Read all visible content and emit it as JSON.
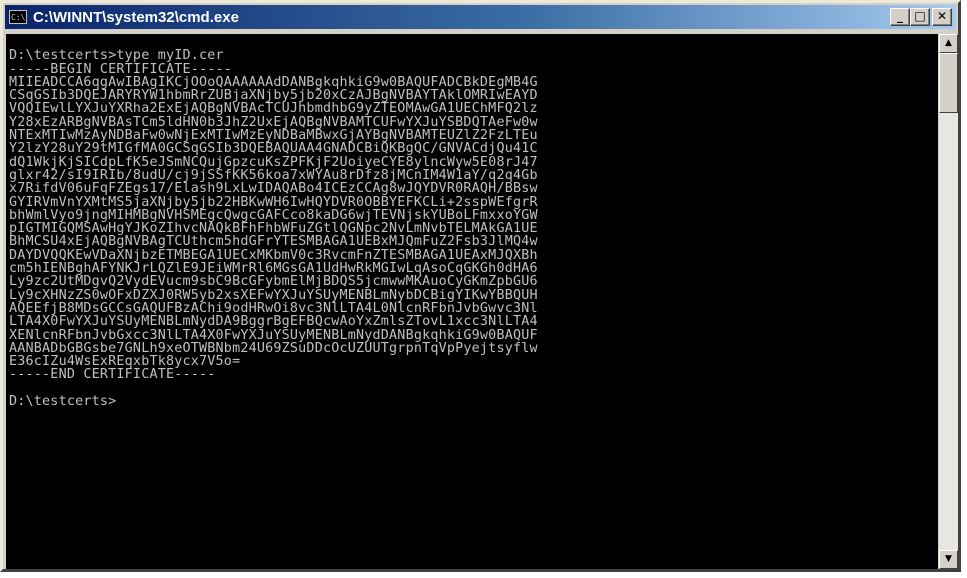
{
  "window": {
    "title": "C:\\WINNT\\system32\\cmd.exe",
    "icon": "cmd-icon",
    "icon_text": "C:\\",
    "buttons": {
      "minimize": "_",
      "maximize": "□",
      "close": "✕"
    }
  },
  "console": {
    "text": "\nD:\\testcerts>type myID.cer\n-----BEGIN CERTIFICATE-----\nMIIEADCCA6qgAwIBAgIKCjOOoQAAAAAAdDANBgkqhkiG9w0BAQUFADCBkDEgMB4G\nCSqGSIb3DQEJARYRYW1hbmRrZUBjaXNjby5jb20xCzAJBgNVBAYTAklOMRIwEAYD\nVQQIEwlLYXJuYXRha2ExEjAQBgNVBAcTCUJhbmdhbG9yZTEOMAwGA1UEChMFQ2lz\nY28xEzARBgNVBAsTCm5ldHN0b3JhZ2UxEjAQBgNVBAMTCUFwYXJuYSBDQTAeFw0w\nNTExMTIwMzAyNDBaFw0wNjExMTIwMzEyNDBaMBwxGjAYBgNVBAMTEUZlZ2FzLTEu\nY2lzY28uY29tMIGfMA0GCSqGSIb3DQEBAQUAA4GNADCBiQKBgQC/GNVACdjQu41C\ndQ1WkjKjSICdpLfK5eJSmNCQujGpzcuKsZPFKjF2UoiyeCYE8ylncWyw5E08rJ47\nglxr42/sI9IRIb/8udU/cj9jSSfKK56koa7xWYAu8rDfz8jMCnIM4W1aY/q2q4Gb\nx7RifdV06uFqFZEgs17/Elash9LxLwIDAQABo4ICEzCCAg8wJQYDVR0RAQH/BBsw\nGYIRVmVnYXMtMS5jaXNjby5jb22HBKwWH6IwHQYDVR0OBBYEFKCLi+2sspWEfgrR\nbhWmlVyo9jngMIHMBgNVHSMEgcQwgcGAFCco8kaDG6wjTEVNjskYUBoLFmxxoYGW\npIGTMIGQMSAwHgYJKoZIhvcNAQkBFhFhbWFuZGtlQGNpc2NvLmNvbTELMAkGA1UE\nBhMCSU4xEjAQBgNVBAgTCUthcm5hdGFrYTESMBAGA1UEBxMJQmFuZ2Fsb3JlMQ4w\nDAYDVQQKEwVDaXNjbzETMBEGA1UECxMKbmV0c3RvcmFnZTESMBAGA1UEAxMJQXBh\ncm5hIENBghAFYNKJrLQZlE9JEiWMrRl6MGsGA1UdHwRkMGIwLqAsoCqGKGh0dHA6\nLy9zc2UtMDgvQ2VydEVucm9sbC9BcGFybmElMjBDQS5jcmwwMKAuoCyGKmZpbGU6\nLy9cXHNzZS0wOFxDZXJ0RW5yb2xsXEFwYXJuYSUyMENBLmNybDCBigYIKwYBBQUH\nAQEEfjB8MDsGCCsGAQUFBzAChi9odHRwOi8vc3NlLTA4L0NlcnRFbnJvbGwvc3Nl\nLTA4X0FwYXJuYSUyMENBLmNydDA9BggrBgEFBQcwAoYxZmlsZTovL1xcc3NlLTA4\nXENlcnRFbnJvbGxcc3NlLTA4X0FwYXJuYSUyMENBLmNydDANBgkqhkiG9w0BAQUF\nAANBADbGBGsbe7GNLh9xeOTWBNbm24U69ZSuDDcOcUZUUTgrpnTqVpPyejtsyflw\nE36cIZu4WsExREqxbTk8ycx7V5o=\n-----END CERTIFICATE-----\n\nD:\\testcerts>"
  },
  "scrollbar": {
    "up_arrow": "▲",
    "down_arrow": "▼"
  }
}
